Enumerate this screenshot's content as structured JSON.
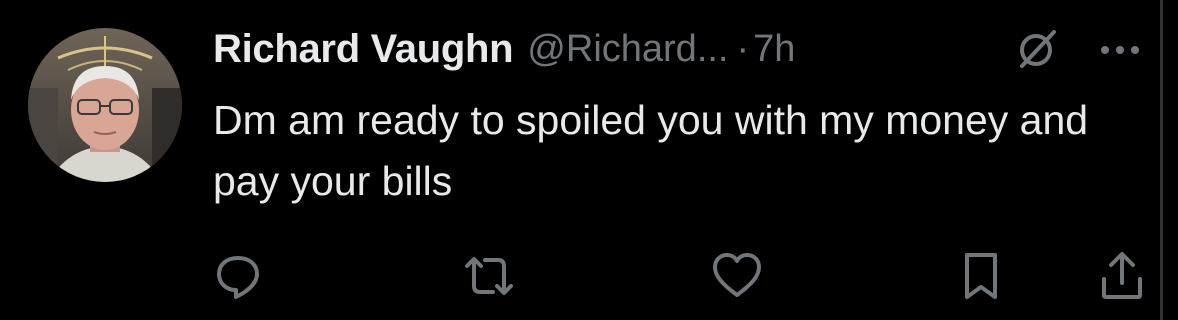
{
  "tweet": {
    "display_name": "Richard Vaughn",
    "handle": "@Richard...",
    "separator": "·",
    "time": "7h",
    "text": "Dm am ready to spoiled you with my money and pay your bills"
  },
  "icons": {
    "grok": "grok-icon",
    "more": "more-horizontal-icon",
    "reply": "reply-icon",
    "repost": "repost-icon",
    "like": "heart-icon",
    "bookmark": "bookmark-icon",
    "share": "share-icon"
  },
  "colors": {
    "background": "#000000",
    "primary_text": "#e7e9ea",
    "secondary_text": "#71767b"
  }
}
